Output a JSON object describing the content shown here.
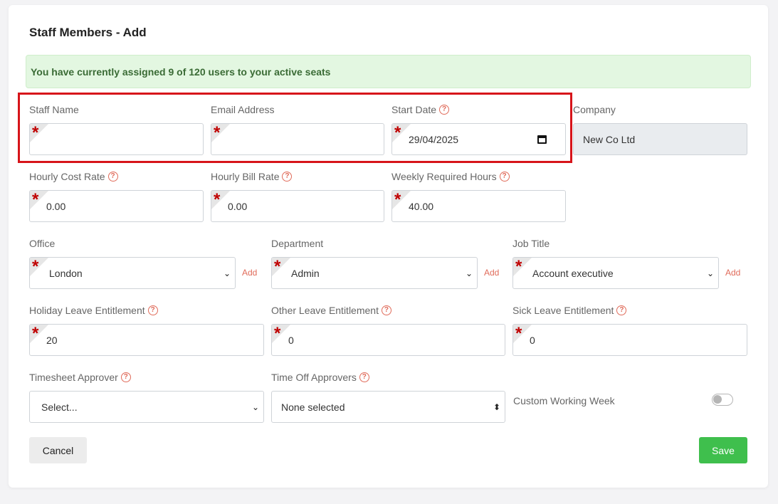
{
  "page": {
    "title": "Staff Members - Add",
    "alert": "You have currently assigned 9 of 120 users to your active seats"
  },
  "fields": {
    "staff_name": {
      "label": "Staff Name",
      "value": ""
    },
    "email": {
      "label": "Email Address",
      "value": ""
    },
    "start_date": {
      "label": "Start Date",
      "value": "29/04/2025"
    },
    "company": {
      "label": "Company",
      "value": "New Co Ltd"
    },
    "hourly_cost": {
      "label": "Hourly Cost Rate",
      "value": "0.00"
    },
    "hourly_bill": {
      "label": "Hourly Bill Rate",
      "value": "0.00"
    },
    "weekly_hours": {
      "label": "Weekly Required Hours",
      "value": "40.00"
    },
    "office": {
      "label": "Office",
      "value": "London"
    },
    "department": {
      "label": "Department",
      "value": "Admin"
    },
    "job_title": {
      "label": "Job Title",
      "value": "Account executive"
    },
    "holiday_leave": {
      "label": "Holiday Leave Entitlement",
      "value": "20"
    },
    "other_leave": {
      "label": "Other Leave Entitlement",
      "value": "0"
    },
    "sick_leave": {
      "label": "Sick Leave Entitlement",
      "value": "0"
    },
    "timesheet_approver": {
      "label": "Timesheet Approver",
      "value": "Select..."
    },
    "time_off_approvers": {
      "label": "Time Off Approvers",
      "value": "None selected"
    },
    "custom_week": {
      "label": "Custom Working Week",
      "enabled": false
    }
  },
  "labels": {
    "add": "Add",
    "required_marker": "*",
    "help_marker": "?",
    "caret": "⌄",
    "updown": "⬍"
  },
  "buttons": {
    "cancel": "Cancel",
    "save": "Save"
  },
  "colors": {
    "save": "#3fbf4d",
    "required": "#c00000",
    "help": "#e06b5a",
    "highlight": "#d7141a",
    "alert_bg": "#e3f7e1"
  }
}
